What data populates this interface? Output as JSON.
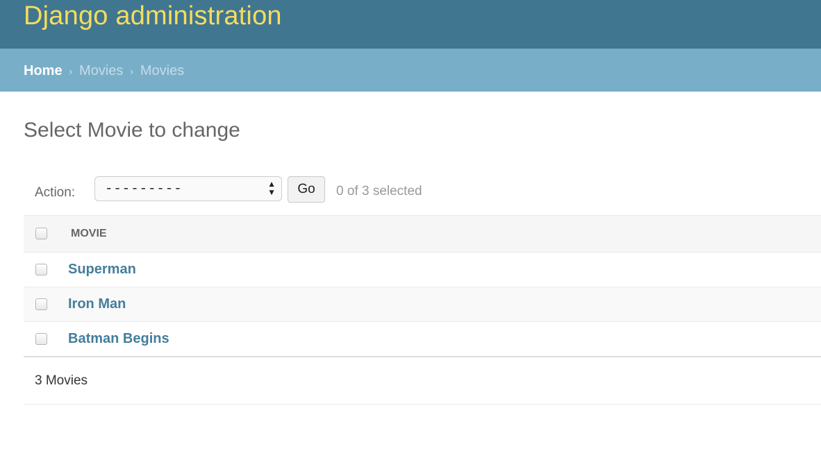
{
  "header": {
    "site_name": "Django administration"
  },
  "breadcrumbs": {
    "home": "Home",
    "separator": "›",
    "app": "Movies",
    "model": "Movies"
  },
  "page": {
    "title": "Select Movie to change"
  },
  "actions": {
    "label": "Action:",
    "selected_option": "---------",
    "go_label": "Go",
    "counter": "0 of 3 selected"
  },
  "table": {
    "column_header": "MOVIE",
    "rows": [
      {
        "title": "Superman"
      },
      {
        "title": "Iron Man"
      },
      {
        "title": "Batman Begins"
      }
    ]
  },
  "paginator": {
    "text": "3 Movies"
  },
  "colors": {
    "header_bg": "#417690",
    "site_name": "#f5dd5d",
    "breadcrumb_bg": "#79aec8",
    "link": "#447e9b"
  }
}
